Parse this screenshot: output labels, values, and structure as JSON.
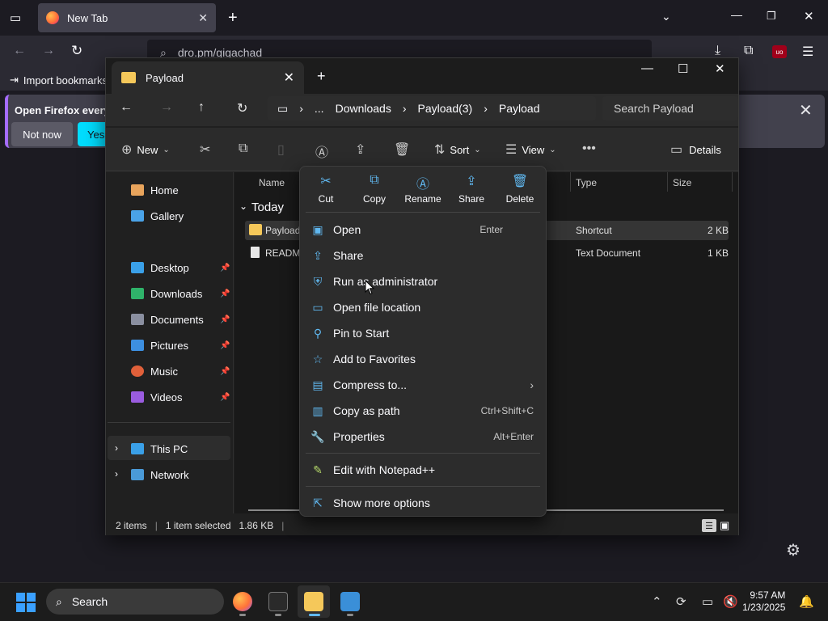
{
  "firefox": {
    "tab_title": "New Tab",
    "url": "dro.pm/gigachad",
    "bookmarks_import": "Import bookmarks...",
    "notification_title": "Open Firefox every",
    "not_now": "Not now",
    "yes": "Yes,"
  },
  "explorer": {
    "tab_title": "Payload",
    "breadcrumb": [
      "...",
      "Downloads",
      "Payload(3)",
      "Payload"
    ],
    "search_placeholder": "Search Payload",
    "toolbar": {
      "new": "New",
      "sort": "Sort",
      "view": "View",
      "details": "Details"
    },
    "sidebar": {
      "home": "Home",
      "gallery": "Gallery",
      "desktop": "Desktop",
      "downloads": "Downloads",
      "documents": "Documents",
      "pictures": "Pictures",
      "music": "Music",
      "videos": "Videos",
      "this_pc": "This PC",
      "network": "Network"
    },
    "columns": {
      "name": "Name",
      "type": "Type",
      "size": "Size"
    },
    "group": "Today",
    "files": [
      {
        "name": "Payload",
        "type": "Shortcut",
        "size": "2 KB"
      },
      {
        "name": "READM",
        "type": "Text Document",
        "size": "1 KB"
      }
    ],
    "status": {
      "items": "2 items",
      "selected": "1 item selected",
      "size": "1.86 KB"
    }
  },
  "context_menu": {
    "quick_actions": [
      "Cut",
      "Copy",
      "Rename",
      "Share",
      "Delete"
    ],
    "items": [
      {
        "label": "Open",
        "shortcut": "Enter"
      },
      {
        "label": "Share",
        "shortcut": ""
      },
      {
        "label": "Run as administrator",
        "shortcut": ""
      },
      {
        "label": "Open file location",
        "shortcut": ""
      },
      {
        "label": "Pin to Start",
        "shortcut": ""
      },
      {
        "label": "Add to Favorites",
        "shortcut": ""
      },
      {
        "label": "Compress to...",
        "shortcut": ""
      },
      {
        "label": "Copy as path",
        "shortcut": "Ctrl+Shift+C"
      },
      {
        "label": "Properties",
        "shortcut": "Alt+Enter"
      },
      {
        "label": "Edit with Notepad++",
        "shortcut": ""
      },
      {
        "label": "Show more options",
        "shortcut": ""
      }
    ]
  },
  "taskbar": {
    "search": "Search",
    "time": "9:57 AM",
    "date": "1/23/2025"
  },
  "colors": {
    "accent": "#60b8f0",
    "firefox_yes": "#00ddff",
    "folder": "#f5c85a"
  }
}
